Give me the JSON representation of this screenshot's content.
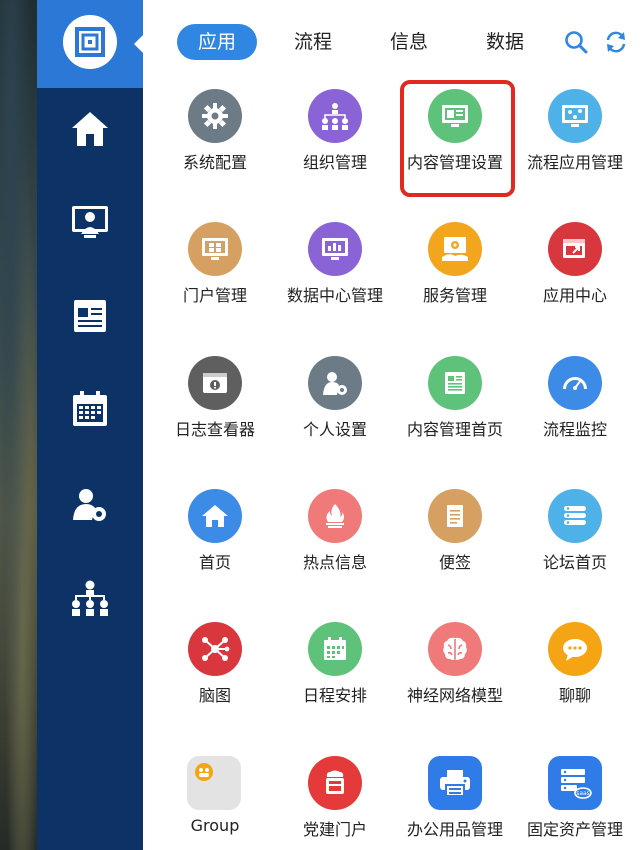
{
  "tabs": [
    {
      "label": "应用",
      "active": true
    },
    {
      "label": "流程",
      "active": false
    },
    {
      "label": "信息",
      "active": false
    },
    {
      "label": "数据",
      "active": false
    }
  ],
  "toolbar_icons": [
    "search-icon",
    "refresh-icon"
  ],
  "sidebar_icons": [
    "logo-icon",
    "home-icon",
    "monitor-user-icon",
    "news-icon",
    "calendar-icon",
    "user-settings-icon",
    "org-chart-icon"
  ],
  "apps": [
    {
      "label": "系统配置",
      "icon": "gear-icon",
      "color": "#6c7b86"
    },
    {
      "label": "组织管理",
      "icon": "org-icon",
      "color": "#8a63d6"
    },
    {
      "label": "内容管理设置",
      "icon": "content-settings-icon",
      "color": "#5ec27a",
      "highlighted": true
    },
    {
      "label": "流程应用管理",
      "icon": "flow-app-icon",
      "color": "#4eb1e8"
    },
    {
      "label": "门户管理",
      "icon": "portal-icon",
      "color": "#d6a062"
    },
    {
      "label": "数据中心管理",
      "icon": "data-center-icon",
      "color": "#8a63d6"
    },
    {
      "label": "服务管理",
      "icon": "service-icon",
      "color": "#f2a51d"
    },
    {
      "label": "应用中心",
      "icon": "app-center-icon",
      "color": "#d8383d"
    },
    {
      "label": "日志查看器",
      "icon": "log-viewer-icon",
      "color": "#5f5f5f"
    },
    {
      "label": "个人设置",
      "icon": "personal-settings-icon",
      "color": "#6c7b86"
    },
    {
      "label": "内容管理首页",
      "icon": "content-home-icon",
      "color": "#5ec27a"
    },
    {
      "label": "流程监控",
      "icon": "gauge-icon",
      "color": "#3c8be6"
    },
    {
      "label": "首页",
      "icon": "home-icon",
      "color": "#3c8be6"
    },
    {
      "label": "热点信息",
      "icon": "hotspot-icon",
      "color": "#f07a7a"
    },
    {
      "label": "便签",
      "icon": "notepad-icon",
      "color": "#d6a062"
    },
    {
      "label": "论坛首页",
      "icon": "forum-icon",
      "color": "#4eb1e8"
    },
    {
      "label": "脑图",
      "icon": "mindmap-icon",
      "color": "#d8383d"
    },
    {
      "label": "日程安排",
      "icon": "schedule-icon",
      "color": "#5ec27a"
    },
    {
      "label": "神经网络模型",
      "icon": "brain-icon",
      "color": "#f07a7a"
    },
    {
      "label": "聊聊",
      "icon": "chat-icon",
      "color": "#f5a514"
    },
    {
      "label": "Group",
      "icon": "group-icon",
      "color": "#e3e3e3"
    },
    {
      "label": "党建门户",
      "icon": "party-portal-icon",
      "color": "#e53a3a"
    },
    {
      "label": "办公用品管理",
      "icon": "printer-icon",
      "color": "#2f7be8"
    },
    {
      "label": "固定资产管理",
      "icon": "server-saas-icon",
      "color": "#2f7be8"
    }
  ]
}
